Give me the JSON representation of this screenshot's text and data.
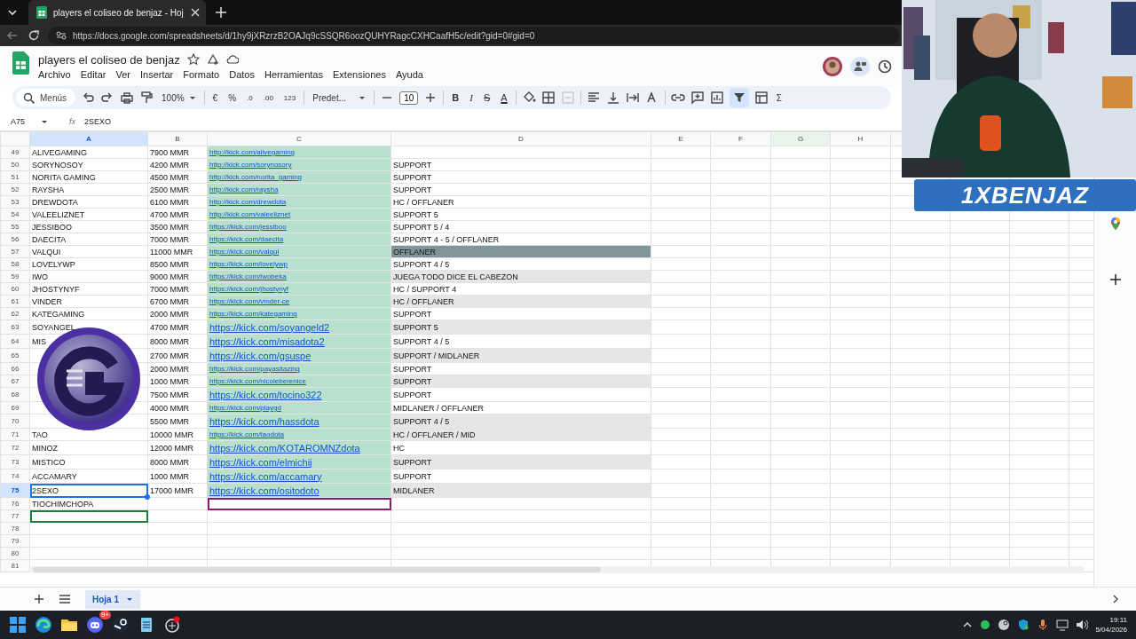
{
  "browser": {
    "tab_title": "players el coliseo de benjaz - Hoj",
    "url": "https://docs.google.com/spreadsheets/d/1hy9jXRzrzB2OAJq9cSSQR6oozQUHYRagcCXHCaafH5c/edit?gid=0#gid=0"
  },
  "document": {
    "title": "players el coliseo de benjaz",
    "menus": [
      "Archivo",
      "Editar",
      "Ver",
      "Insertar",
      "Formato",
      "Datos",
      "Herramientas",
      "Extensiones",
      "Ayuda"
    ]
  },
  "toolbar": {
    "search": "Menús",
    "zoom": "100%",
    "currency": "€",
    "percent": "%",
    "decimal_less": ".0",
    "decimal_more": ".00",
    "number_format": "123",
    "font": "Predet...",
    "font_size": "10",
    "bold": "B",
    "italic": "I",
    "strike": "S",
    "text_color": "A",
    "sum": "Σ",
    "filter_on": true
  },
  "formula_bar": {
    "cell_ref": "A75",
    "fx": "fx",
    "value": "2SEXO"
  },
  "columns": [
    {
      "label": "A",
      "selected": true,
      "peer": false
    },
    {
      "label": "B",
      "selected": false,
      "peer": false
    },
    {
      "label": "C",
      "selected": false,
      "peer": false
    },
    {
      "label": "D",
      "selected": false,
      "peer": false
    },
    {
      "label": "E",
      "selected": false,
      "peer": false
    },
    {
      "label": "F",
      "selected": false,
      "peer": false
    },
    {
      "label": "G",
      "selected": false,
      "peer": true
    },
    {
      "label": "H",
      "selected": false,
      "peer": false
    }
  ],
  "rows": [
    {
      "number": "49",
      "name": "ALIVEGAMING",
      "mmr": "7900 MMR",
      "link": "http://kick.com/alivegaming",
      "big": false,
      "banded": false,
      "emphasized": false,
      "selected": false
    },
    {
      "number": "50",
      "name": "SORYNOSOY",
      "mmr": "4200 MMR",
      "link": "http://kick.com/sorynosory",
      "big": false,
      "role": "SUPPORT",
      "banded": false,
      "emphasized": false,
      "selected": false
    },
    {
      "number": "51",
      "name": "NORITA GAMING",
      "mmr": "4500 MMR",
      "link": "http://kick.com/norita_gaming",
      "big": false,
      "role": "SUPPORT",
      "banded": false,
      "emphasized": false,
      "selected": false
    },
    {
      "number": "52",
      "name": "RAYSHA",
      "mmr": "2500 MMR",
      "link": "http://kick.com/raysha",
      "big": false,
      "role": "SUPPORT",
      "banded": false,
      "emphasized": false,
      "selected": false
    },
    {
      "number": "53",
      "name": "DREWDOTA",
      "mmr": "6100 MMR",
      "link": "http://kick.com/drewdota",
      "big": false,
      "role": "HC / OFFLANER",
      "banded": false,
      "emphasized": false,
      "selected": false
    },
    {
      "number": "54",
      "name": "VALEELIZNET",
      "mmr": "4700 MMR",
      "link": "http://kick.com/valeeliznet",
      "big": false,
      "role": "SUPPORT 5",
      "banded": false,
      "emphasized": false,
      "selected": false
    },
    {
      "number": "55",
      "name": "JESSIBOO",
      "mmr": "3500 MMR",
      "link": "https://kick.com/jessiboo",
      "big": false,
      "role": "SUPPORT 5 / 4",
      "banded": false,
      "emphasized": false,
      "selected": false
    },
    {
      "number": "56",
      "name": "DAECITA",
      "mmr": "7000 MMR",
      "link": "https://kick.com/daecita",
      "big": false,
      "role": "SUPPORT 4 - 5 / OFFLANER",
      "banded": false,
      "emphasized": false,
      "selected": false
    },
    {
      "number": "57",
      "name": "VALQUI",
      "mmr": "11000 MMR",
      "link": "https://kick.com/valqui",
      "big": false,
      "role": "OFFLANER",
      "banded": false,
      "emphasized": true,
      "selected": false
    },
    {
      "number": "58",
      "name": "LOVELYWP",
      "mmr": "8500 MMR",
      "link": "https://kick.com/lovelywp",
      "big": false,
      "role": "SUPPORT 4 / 5",
      "banded": false,
      "emphasized": false,
      "selected": false
    },
    {
      "number": "59",
      "name": "IWO",
      "mmr": "9000 MMR",
      "link": "https://kick.com/iwobeka",
      "big": false,
      "role": "JUEGA TODO DICE EL CABEZON",
      "banded": true,
      "emphasized": false,
      "selected": false
    },
    {
      "number": "60",
      "name": "JHOSTYNYF",
      "mmr": "7000 MMR",
      "link": "https://kick.com/jhostynyf",
      "big": false,
      "role": "HC / SUPPORT 4",
      "banded": false,
      "emphasized": false,
      "selected": false
    },
    {
      "number": "61",
      "name": "VINDER",
      "mmr": "6700 MMR",
      "link": "https://kick.com/vinder-ce",
      "big": false,
      "role": "HC / OFFLANER",
      "banded": true,
      "emphasized": false,
      "selected": false
    },
    {
      "number": "62",
      "name": "KATEGAMING",
      "mmr": "2000 MMR",
      "link": "https://kick.com/kategaming",
      "big": false,
      "role": "SUPPORT",
      "banded": false,
      "emphasized": false,
      "selected": false
    },
    {
      "number": "63",
      "name": "SOYANGEL",
      "mmr": "4700 MMR",
      "link": "https://kick.com/soyangeld2",
      "big": true,
      "role": "SUPPORT 5",
      "banded": true,
      "emphasized": false,
      "selected": false
    },
    {
      "number": "64",
      "name": "MIS",
      "mmr": "8000 MMR",
      "link": "https://kick.com/misadota2",
      "big": true,
      "role": "SUPPORT 4 / 5",
      "banded": false,
      "emphasized": false,
      "selected": false
    },
    {
      "number": "65",
      "mmr": "2700 MMR",
      "link": "https://kick.com/gsuspe",
      "big": true,
      "role": "SUPPORT / MIDLANER",
      "banded": true,
      "emphasized": false,
      "selected": false
    },
    {
      "number": "66",
      "mmr": "2000 MMR",
      "link": "https://kick.com/payasitazing",
      "big": false,
      "role": "SUPPORT",
      "banded": false,
      "emphasized": false,
      "selected": false
    },
    {
      "number": "67",
      "mmr": "1000 MMR",
      "link": "https://kick.com/nicoleberenice",
      "big": false,
      "role": "SUPPORT",
      "banded": true,
      "emphasized": false,
      "selected": false
    },
    {
      "number": "68",
      "mmr": "7500 MMR",
      "link": "https://kick.com/tocino322",
      "big": true,
      "role": "SUPPORT",
      "banded": false,
      "emphasized": false,
      "selected": false
    },
    {
      "number": "69",
      "mmr": "4000 MMR",
      "link": "https://kick.com/playgd",
      "big": false,
      "role": "MIDLANER / OFFLANER",
      "banded": false,
      "emphasized": false,
      "selected": false
    },
    {
      "number": "70",
      "mmr": "5500 MMR",
      "link": "https://kick.com/hassdota",
      "big": true,
      "role": "SUPPORT 4 / 5",
      "banded": true,
      "emphasized": false,
      "selected": false
    },
    {
      "number": "71",
      "name": "TAO",
      "mmr": "10000 MMR",
      "link": "https://kick.com/taodota",
      "big": false,
      "role": "HC / OFFLANER / MID",
      "banded": true,
      "emphasized": false,
      "selected": false
    },
    {
      "number": "72",
      "name": "MINOZ",
      "mmr": "12000 MMR",
      "link": "https://kick.com/KOTAROMNZdota",
      "big": true,
      "role": "HC",
      "banded": false,
      "emphasized": false,
      "selected": false
    },
    {
      "number": "73",
      "name": "MISTICO",
      "mmr": "8000 MMR",
      "link": "https://kick.com/elmichij",
      "big": true,
      "role": "SUPPORT",
      "banded": true,
      "emphasized": false,
      "selected": false
    },
    {
      "number": "74",
      "name": "ACCAMARY",
      "mmr": "1000 MMR",
      "link": "https://kick.com/accamary",
      "big": true,
      "role": "SUPPORT",
      "banded": false,
      "emphasized": false,
      "selected": false
    },
    {
      "number": "75",
      "name": "2SEXO",
      "mmr": "17000 MMR",
      "link": "https://kick.com/ositodoto",
      "big": true,
      "role": "MIDLANER",
      "banded": true,
      "emphasized": false,
      "selected": true
    },
    {
      "number": "76",
      "name": "TIOCHIMCHOPA",
      "selected": false,
      "link_cursor": {
        "color": "#8e1c6e"
      }
    },
    {
      "number": "77",
      "selected": false,
      "name_cursor": {
        "color": "#1e7d3a"
      }
    },
    {
      "number": "78",
      "selected": false
    },
    {
      "number": "79",
      "selected": false
    },
    {
      "number": "80",
      "selected": false
    },
    {
      "number": "81",
      "selected": false
    }
  ],
  "sheet_tabs": [
    {
      "label": "Hoja 1",
      "selected": true
    }
  ],
  "overlay": {
    "banner": "1XBENJAZ"
  },
  "taskbar": {
    "discord_badge": "9+",
    "time": "19:11",
    "date": "5/04/2026"
  }
}
